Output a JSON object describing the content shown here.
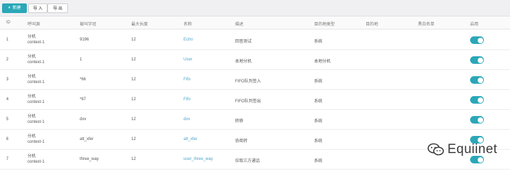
{
  "toolbar": {
    "new_label": "新建",
    "import_label": "导 入",
    "export_label": "导 出"
  },
  "columns": [
    "ID",
    "呼叫源",
    "被叫字冠",
    "最大长度",
    "名称",
    "描述",
    "目的地类型",
    "目的地",
    "黑白名单",
    "启用"
  ],
  "rows": [
    {
      "id": "1",
      "source_line1": "分机",
      "source_line2": "context-1",
      "prefix": "9196",
      "max_len": "12",
      "name": "Echo",
      "desc": "回音测试",
      "dest_type": "系统",
      "dest": "",
      "list": "",
      "enabled": true
    },
    {
      "id": "2",
      "source_line1": "分机",
      "source_line2": "context-1",
      "prefix": "1",
      "max_len": "12",
      "name": "User",
      "desc": "本地分机",
      "dest_type": "本地分机",
      "dest": "",
      "list": "",
      "enabled": true
    },
    {
      "id": "3",
      "source_line1": "分机",
      "source_line2": "context-1",
      "prefix": "*66",
      "max_len": "12",
      "name": "Fifo",
      "desc": "FIFO队列签入",
      "dest_type": "系统",
      "dest": "",
      "list": "",
      "enabled": true
    },
    {
      "id": "4",
      "source_line1": "分机",
      "source_line2": "context-1",
      "prefix": "*67",
      "max_len": "12",
      "name": "Fifo",
      "desc": "FIFO队列签出",
      "dest_type": "系统",
      "dest": "",
      "list": "",
      "enabled": true
    },
    {
      "id": "5",
      "source_line1": "分机",
      "source_line2": "context-1",
      "prefix": "dxx",
      "max_len": "12",
      "name": "dxx",
      "desc": "转移",
      "dest_type": "系统",
      "dest": "",
      "list": "",
      "enabled": true
    },
    {
      "id": "6",
      "source_line1": "分机",
      "source_line2": "context-1",
      "prefix": "att_xfer",
      "max_len": "12",
      "name": "att_xfer",
      "desc": "协商转",
      "dest_type": "系统",
      "dest": "",
      "list": "",
      "enabled": true
    },
    {
      "id": "7",
      "source_line1": "分机",
      "source_line2": "context-1",
      "prefix": "three_way",
      "max_len": "12",
      "name": "user_three_way",
      "desc": "拉取三方通话",
      "dest_type": "系统",
      "dest": "",
      "list": "",
      "enabled": true
    }
  ],
  "watermark": {
    "text": "Equiinet",
    "icon": "wechat-icon"
  },
  "colors": {
    "accent": "#2aa7b8",
    "link": "#4aa3c9"
  }
}
